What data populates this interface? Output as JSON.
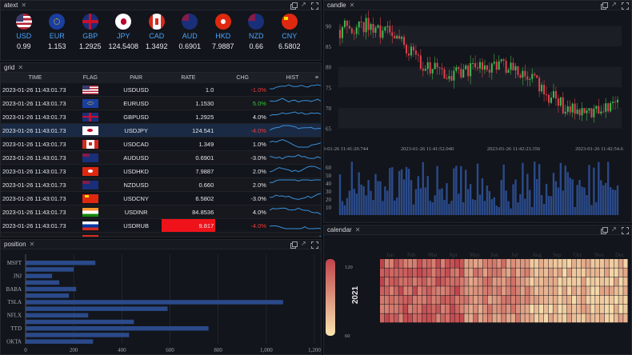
{
  "atext": {
    "title": "atext",
    "currencies": [
      {
        "code": "USD",
        "rate": "0.99"
      },
      {
        "code": "EUR",
        "rate": "1.153"
      },
      {
        "code": "GBP",
        "rate": "1.2925"
      },
      {
        "code": "JPY",
        "rate": "124.5408"
      },
      {
        "code": "CAD",
        "rate": "1.3492"
      },
      {
        "code": "AUD",
        "rate": "0.6901"
      },
      {
        "code": "HKD",
        "rate": "7.9887"
      },
      {
        "code": "NZD",
        "rate": "0.66"
      },
      {
        "code": "CNY",
        "rate": "6.5802"
      }
    ]
  },
  "grid": {
    "title": "grid",
    "headers": [
      "TIME",
      "FLAG",
      "PAIR",
      "RATE",
      "CHG",
      "HIST"
    ],
    "rows": [
      {
        "time": "2023-01-26 11:43:01.73",
        "pair": "USDUSD",
        "rate": "1.0",
        "chg": "-1.0%",
        "chg_dir": "neg",
        "rate_hl": ""
      },
      {
        "time": "2023-01-26 11:43:01.73",
        "pair": "EURUSD",
        "rate": "1.1530",
        "chg": "5.0%",
        "chg_dir": "pos",
        "rate_hl": "up"
      },
      {
        "time": "2023-01-26 11:43:01.73",
        "pair": "GBPUSD",
        "rate": "1.2925",
        "chg": "4.0%",
        "chg_dir": "",
        "rate_hl": ""
      },
      {
        "time": "2023-01-26 11:43:01.73",
        "pair": "USDJPY",
        "rate": "124.541",
        "chg": "-4.0%",
        "chg_dir": "neg",
        "rate_hl": "dn"
      },
      {
        "time": "2023-01-26 11:43:01.73",
        "pair": "USDCAD",
        "rate": "1.349",
        "chg": "1.0%",
        "chg_dir": "",
        "rate_hl": ""
      },
      {
        "time": "2023-01-26 11:43:01.73",
        "pair": "AUDUSD",
        "rate": "0.6901",
        "chg": "-3.0%",
        "chg_dir": "",
        "rate_hl": ""
      },
      {
        "time": "2023-01-26 11:43:01.73",
        "pair": "USDHKD",
        "rate": "7.9887",
        "chg": "2.0%",
        "chg_dir": "",
        "rate_hl": ""
      },
      {
        "time": "2023-01-26 11:43:01.73",
        "pair": "NZDUSD",
        "rate": "0.660",
        "chg": "2.0%",
        "chg_dir": "",
        "rate_hl": ""
      },
      {
        "time": "2023-01-26 11:43:01.73",
        "pair": "USDCNY",
        "rate": "6.5802",
        "chg": "-3.0%",
        "chg_dir": "",
        "rate_hl": ""
      },
      {
        "time": "2023-01-26 11:43:01.73",
        "pair": "USDINR",
        "rate": "84.8536",
        "chg": "4.0%",
        "chg_dir": "",
        "rate_hl": ""
      },
      {
        "time": "2023-01-26 11:43:01.73",
        "pair": "USDRUB",
        "rate": "9.817",
        "chg": "-4.0%",
        "chg_dir": "neg",
        "rate_hl": "dn"
      },
      {
        "time": "2023-01-26 11:43:01.73",
        "pair": "USDCHF",
        "rate": "0.1370",
        "chg": "1.0%",
        "chg_dir": "",
        "rate_hl": ""
      }
    ]
  },
  "position": {
    "title": "position",
    "chart_data": {
      "type": "bar",
      "orientation": "horizontal",
      "categories": [
        "OKTA",
        "TTD",
        "NFLX",
        "TSLA",
        "BABA",
        "JNJ",
        "MSFT"
      ],
      "values": [
        280,
        430,
        760,
        450,
        260,
        590,
        1070,
        180,
        210,
        140,
        110,
        200,
        290
      ],
      "labeled_rows": [
        "MSFT",
        "JNJ",
        "BABA",
        "TSLA",
        "NFLX",
        "TTD",
        "OKTA"
      ],
      "xticks": [
        "0",
        "200",
        "400",
        "600",
        "800",
        "1,000",
        "1,200"
      ],
      "xlim": [
        0,
        1200
      ]
    }
  },
  "candle": {
    "title": "candle",
    "chart_data": {
      "type": "candlestick",
      "yticks": [
        "90",
        "85",
        "80",
        "75",
        "70",
        "65"
      ],
      "ylim": [
        61,
        93
      ],
      "xticks": [
        "2023-01-26 11:41:20.744",
        "2023-01-26 11:41:52.040",
        "2023-01-26 11:42:23.356",
        "2023-01-26 11:42:54.6"
      ],
      "volume_yticks": [
        "60",
        "50",
        "40",
        "30",
        "20",
        "10"
      ],
      "volume_ylim": [
        0,
        70
      ]
    }
  },
  "calendar": {
    "title": "calendar",
    "year": "2021",
    "months": [
      "Jan",
      "Feb",
      "Mar",
      "Apr",
      "May",
      "Jun",
      "Jul",
      "Aug",
      "Sep",
      "Oct",
      "Nov",
      "Dec"
    ],
    "scale": {
      "max": "120",
      "min": "60"
    },
    "colors": {
      "high": "#c0444c",
      "low": "#f8e5b0"
    }
  }
}
